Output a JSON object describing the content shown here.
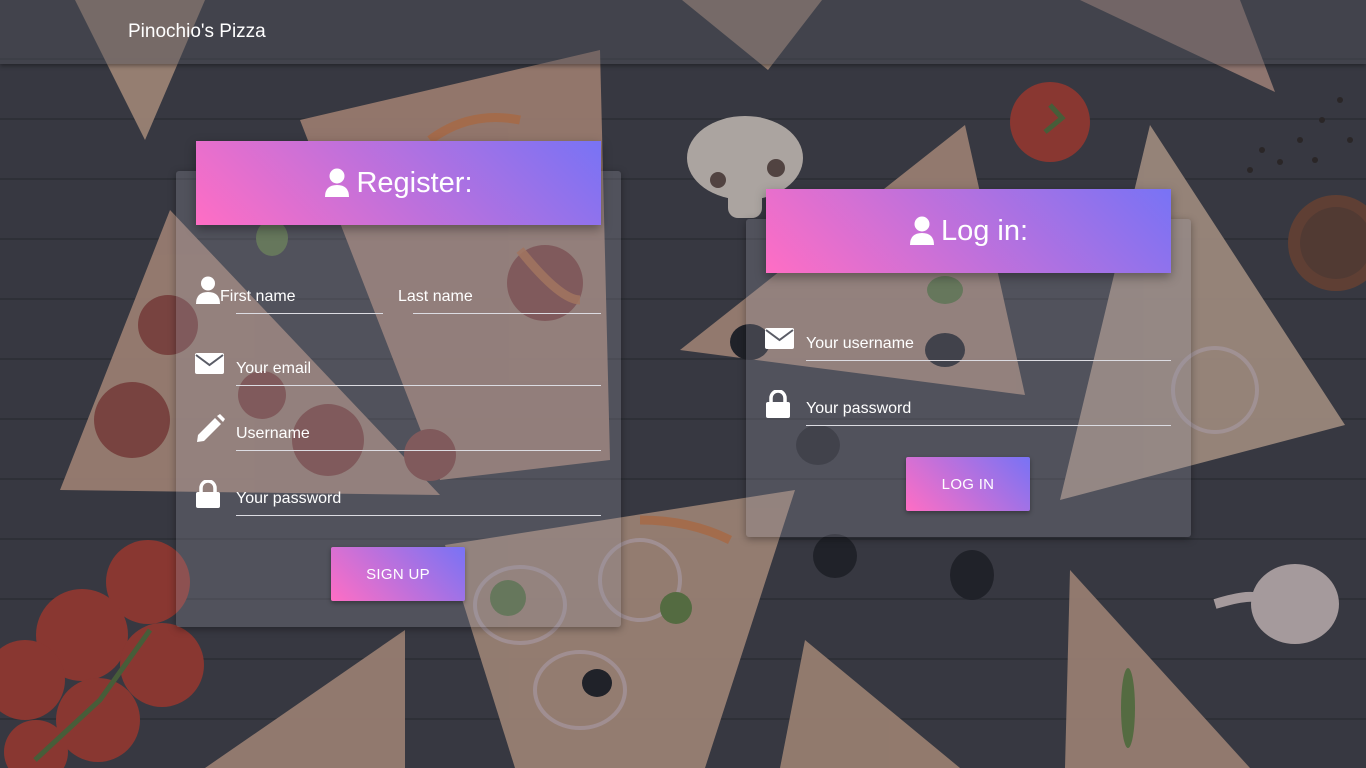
{
  "navbar": {
    "brand": "Pinochio's Pizza"
  },
  "register": {
    "title": "Register:",
    "title_icon": "user-icon",
    "fields": {
      "first_name": "First name",
      "last_name": "Last name",
      "email": "Your email",
      "username": "Username",
      "password": "Your password"
    },
    "icons": [
      "user-icon",
      "envelope-icon",
      "pencil-icon",
      "lock-icon"
    ],
    "submit_label": "SIGN UP"
  },
  "login": {
    "title": "Log in:",
    "title_icon": "user-icon",
    "fields": {
      "username": "Your username",
      "password": "Your password"
    },
    "icons": [
      "envelope-icon",
      "lock-icon"
    ],
    "submit_label": "LOG IN"
  },
  "colors": {
    "gradient_start": "#ff6ec4",
    "gradient_end": "#7873f5",
    "background": "#3b3d45"
  }
}
